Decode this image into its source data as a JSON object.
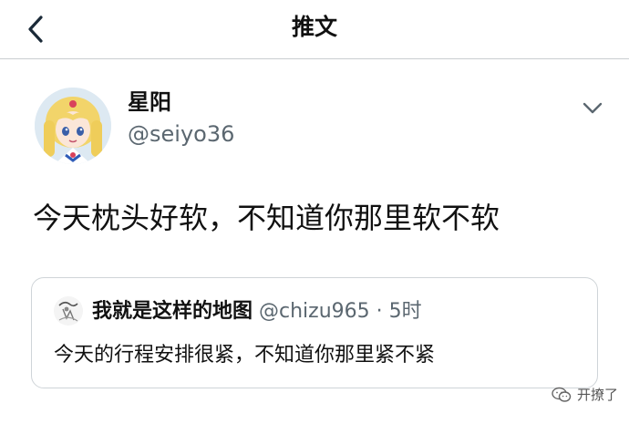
{
  "header": {
    "title": "推文"
  },
  "tweet": {
    "display_name": "星阳",
    "handle": "@seiyo36",
    "text": "今天枕头好软，不知道你那里软不软"
  },
  "quoted_tweet": {
    "display_name": "我就是这样的地图",
    "handle": "@chizu965",
    "separator": "·",
    "time": "5时",
    "text": "今天的行程安排很紧，不知道你那里紧不紧"
  },
  "watermark": {
    "text": "开撩了"
  },
  "icons": {
    "back": "chevron-left-icon",
    "more": "chevron-down-icon",
    "watermark": "wechat-icon"
  },
  "colors": {
    "divider": "#c9cdd1",
    "secondary_text": "#5b6770",
    "primary_text": "#111111",
    "card_border": "#cfd4d8"
  }
}
